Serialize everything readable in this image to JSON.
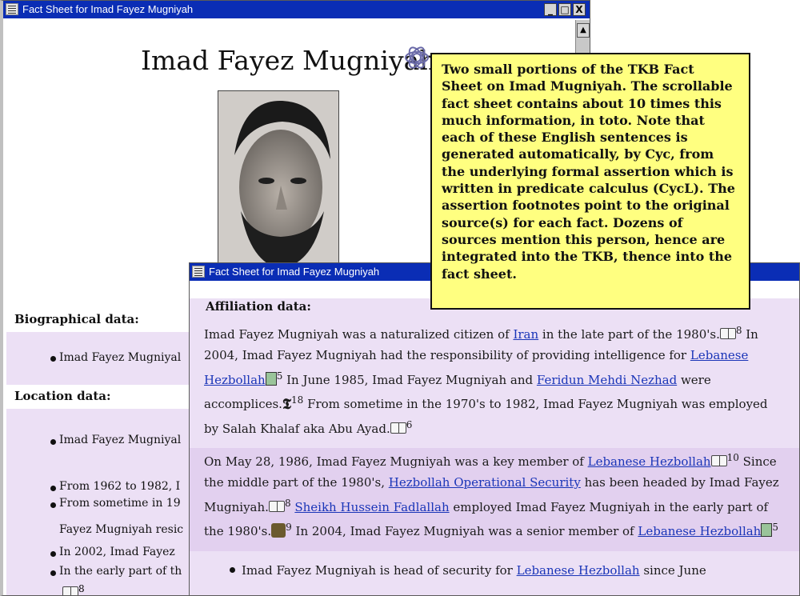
{
  "back_window": {
    "title": "Fact Sheet for Imad Fayez Mugniyah",
    "buttons": {
      "minimize": "_",
      "maximize": "□",
      "close": "X"
    },
    "heading": "Imad Fayez Mugniyah",
    "sections": {
      "biographical": "Biographical data:",
      "location": "Location data:"
    },
    "items": [
      "Imad Fayez Mugniyal",
      "Imad Fayez Mugniyal",
      "From 1962 to 1982, I",
      "From sometime in 19",
      "Fayez Mugniyah resic",
      "In 2002, Imad Fayez",
      "In the early part of th"
    ],
    "footnote": "8"
  },
  "front_window": {
    "title": "Fact Sheet for Imad Fayez Mugniyah",
    "section_title": "Affiliation data:",
    "p1": {
      "t1": "Imad Fayez Mugniyah was a naturalized citizen of ",
      "l1": "Iran",
      "t2": " in the late part of the 1980's.",
      "f1": "8",
      "t3": " In 2004, Imad Fayez Mugniyah had the responsibility of providing intelligence for ",
      "l2": "Lebanese Hezbollah",
      "f2": "5",
      "t4": " In June 1985, Imad Fayez Mugniyah and ",
      "l3": "Feridun Mehdi Nezhad",
      "t5": " were accomplices.",
      "f3": "18",
      "t6": " From sometime in the 1970's to 1982, Imad Fayez Mugniyah was employed by Salah Khalaf aka Abu Ayad.",
      "f4": "6"
    },
    "p2": {
      "t1": "On May 28, 1986, Imad Fayez Mugniyah was a key member of ",
      "l1": "Lebanese Hezbollah",
      "f1": "10",
      "t2": " Since the middle part of the 1980's, ",
      "l2": "Hezbollah Operational Security",
      "t3": " has been headed by Imad Fayez Mugniyah.",
      "f2": "8",
      "l3": "Sheikh Hussein Fadlallah",
      "t4": " employed Imad Fayez Mugniyah in the early part of the 1980's.",
      "f3": "9",
      "t5": " In 2004, Imad Fayez Mugniyah was a senior member of ",
      "l4": "Lebanese Hezbollah",
      "f4": "5"
    },
    "p3": {
      "t1": "Imad Fayez Mugniyah is head of security for ",
      "l1": "Lebanese Hezbollah",
      "t2": " since June"
    }
  },
  "note": "Two small portions of the TKB Fact Sheet on Imad Mugniyah.  The scrollable fact sheet contains about 10 times this much information, in toto.  Note that each of these English sentences is generated automatically, by Cyc, from the underlying formal assertion which is written in predicate calculus (CycL).  The assertion footnotes point to the original source(s) for each fact.  Dozens of sources mention this person, hence are integrated into the TKB, thence into the fact sheet.",
  "colors": {
    "titlebar": "#0a2db5",
    "section_band": "#ece0f5",
    "note_bg": "#ffff80",
    "link": "#1a35b8"
  },
  "icons": [
    "system-menu-icon",
    "cyc-knot-logo",
    "book-source-icon",
    "document-source-icon",
    "nyt-source-icon",
    "photo-source-icon"
  ]
}
